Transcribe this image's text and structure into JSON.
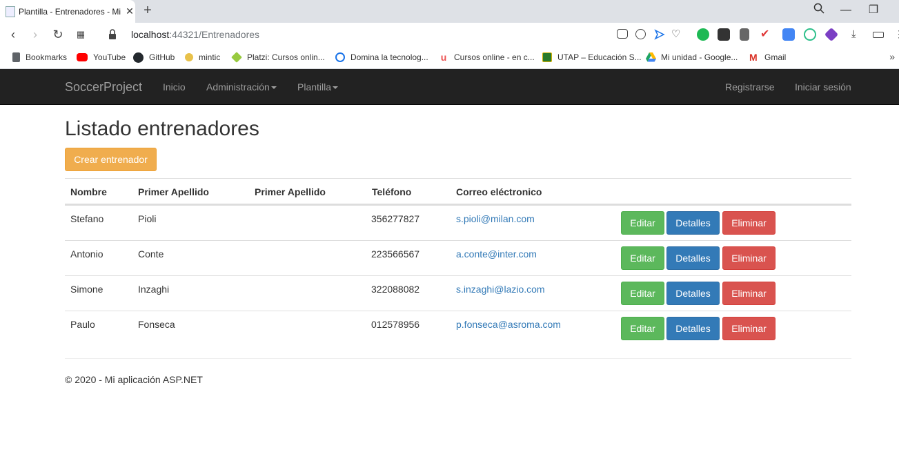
{
  "browser": {
    "tab_title": "Plantilla - Entrenadores - Mi aplicación ASP.NET",
    "url_host": "localhost",
    "url_rest": ":44321/Entrenadores",
    "bookmarks": [
      {
        "label": "Bookmarks",
        "icon": "file-icon",
        "color": "#5f6368"
      },
      {
        "label": "YouTube",
        "icon": "youtube-icon",
        "color": "#ff0000"
      },
      {
        "label": "GitHub",
        "icon": "github-icon",
        "color": "#24292e"
      },
      {
        "label": "mintic",
        "icon": "mintic-icon",
        "color": "#1a1a1a"
      },
      {
        "label": "Platzi: Cursos onlin...",
        "icon": "platzi-icon",
        "color": "#98ca3f"
      },
      {
        "label": "Domina la tecnolog...",
        "icon": "domina-icon",
        "color": "#1a73e8"
      },
      {
        "label": "Cursos online - en c...",
        "icon": "udemy-icon",
        "color": "#ec5252"
      },
      {
        "label": "UTAP – Educación S...",
        "icon": "utap-icon",
        "color": "#2a7a2a"
      },
      {
        "label": "Mi unidad - Google...",
        "icon": "drive-icon",
        "color": "#1fa463"
      },
      {
        "label": "Gmail",
        "icon": "gmail-icon",
        "color": "#d93025"
      }
    ]
  },
  "navbar": {
    "brand": "SoccerProject",
    "links": [
      "Inicio",
      "Administración",
      "Plantilla"
    ],
    "right": [
      "Registrarse",
      "Iniciar sesión"
    ]
  },
  "main": {
    "title": "Listado entrenadores",
    "create_label": "Crear entrenador",
    "headers": [
      "Nombre",
      "Primer Apellido",
      "Primer Apellido",
      "Teléfono",
      "Correo eléctronico"
    ],
    "rows": [
      {
        "nombre": "Stefano",
        "apellido1": "Pioli",
        "apellido2": "",
        "telefono": "356277827",
        "correo": "s.pioli@milan.com"
      },
      {
        "nombre": "Antonio",
        "apellido1": "Conte",
        "apellido2": "",
        "telefono": "223566567",
        "correo": "a.conte@inter.com"
      },
      {
        "nombre": "Simone",
        "apellido1": "Inzaghi",
        "apellido2": "",
        "telefono": "322088082",
        "correo": "s.inzaghi@lazio.com"
      },
      {
        "nombre": "Paulo",
        "apellido1": "Fonseca",
        "apellido2": "",
        "telefono": "012578956",
        "correo": "p.fonseca@asroma.com"
      }
    ],
    "actions": {
      "edit": "Editar",
      "details": "Detalles",
      "delete": "Eliminar"
    }
  },
  "footer": {
    "text": "© 2020 - Mi aplicación ASP.NET"
  },
  "colors": {
    "navbar_bg": "#222222",
    "warning": "#f0ad4e",
    "success": "#5cb85c",
    "primary": "#337ab7",
    "danger": "#d9534f"
  }
}
